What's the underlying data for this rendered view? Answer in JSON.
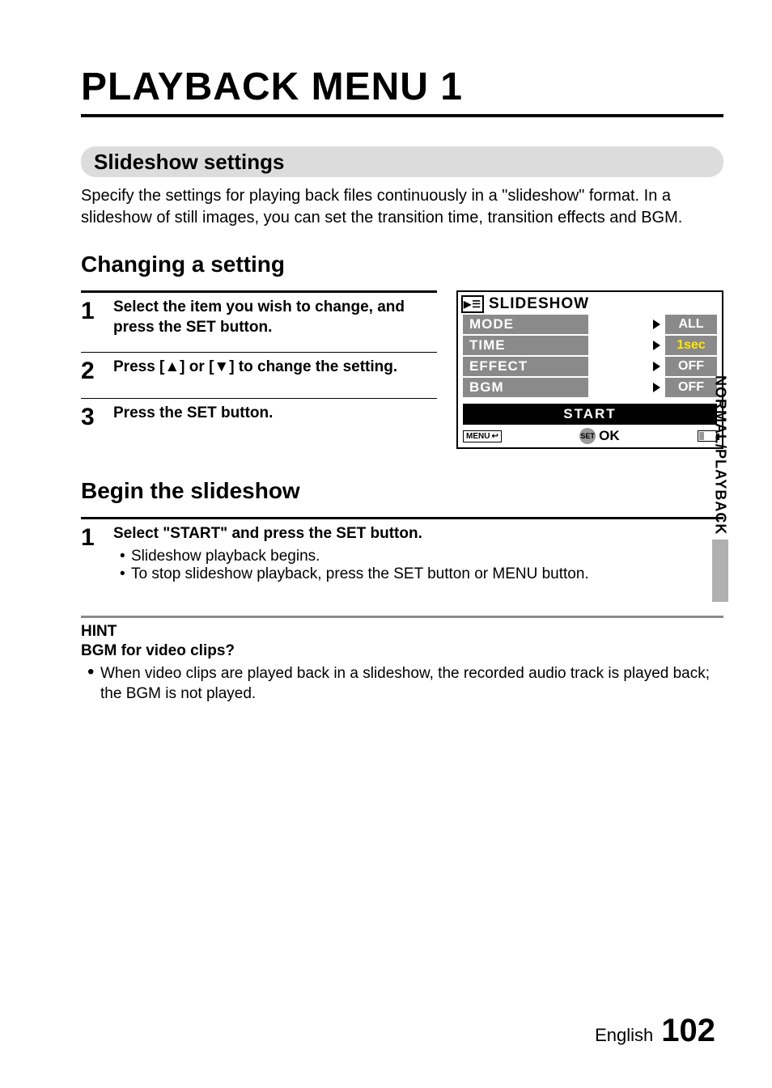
{
  "title": "PLAYBACK MENU 1",
  "section1": {
    "heading": "Slideshow settings",
    "body": "Specify the settings for playing back files continuously in a \"slideshow\" format. In a slideshow of still images, you can set the transition time, transition effects and BGM."
  },
  "changing": {
    "heading": "Changing a setting",
    "steps": [
      {
        "num": "1",
        "text": "Select the item you wish to change, and press the SET button."
      },
      {
        "num": "2",
        "text": "Press [▲] or [▼] to change the setting."
      },
      {
        "num": "3",
        "text": "Press the SET button."
      }
    ]
  },
  "lcd": {
    "title": "SLIDESHOW",
    "rows": [
      {
        "label": "MODE",
        "value": "ALL",
        "active": false
      },
      {
        "label": "TIME",
        "value": "1sec",
        "active": true
      },
      {
        "label": "EFFECT",
        "value": "OFF",
        "active": false
      },
      {
        "label": "BGM",
        "value": "OFF",
        "active": false
      }
    ],
    "start": "START",
    "menu": "MENU",
    "set": "SET",
    "ok": "OK"
  },
  "begin": {
    "heading": "Begin the slideshow",
    "step_num": "1",
    "step_text": "Select \"START\" and press the SET button.",
    "bullets": [
      "Slideshow playback begins.",
      "To stop slideshow playback, press the SET button or MENU button."
    ]
  },
  "hint": {
    "title": "HINT",
    "subtitle": "BGM for video clips?",
    "body": "When video clips are played back in a slideshow, the recorded audio track is played back; the BGM is not played."
  },
  "sidetab": "NORMAL/PLAYBACK",
  "footer": {
    "lang": "English",
    "page": "102"
  }
}
